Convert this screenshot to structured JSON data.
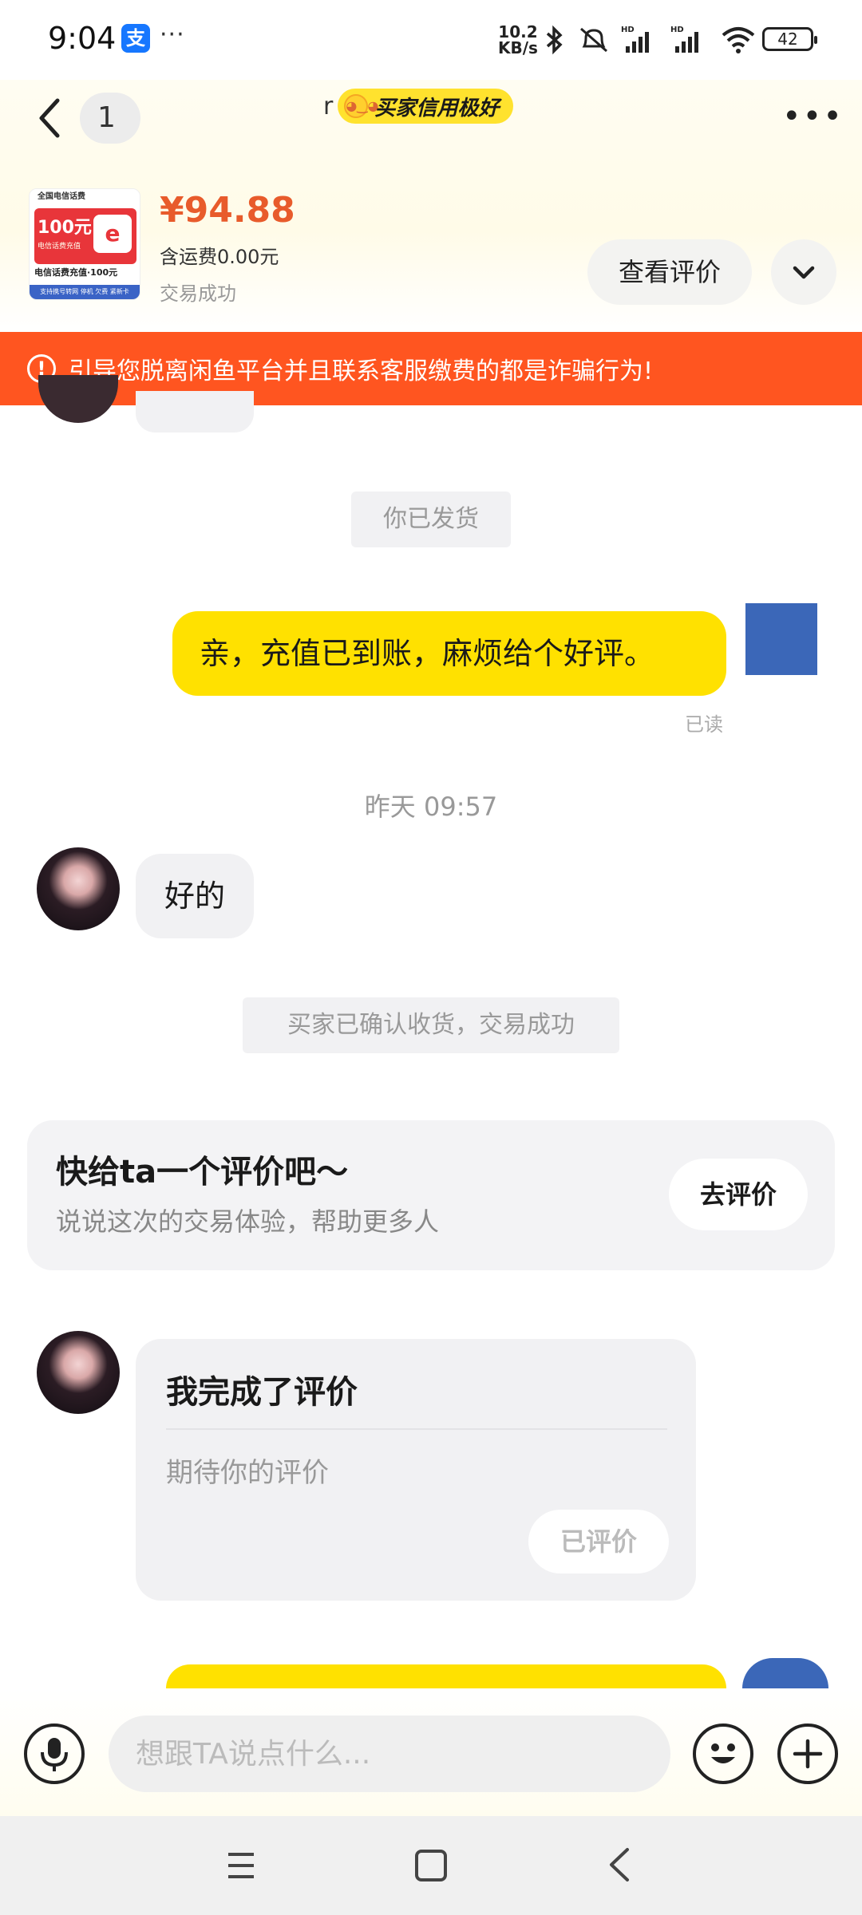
{
  "status_bar": {
    "time": "9:04",
    "app_badge": "支",
    "dots": "···",
    "net_speed_value": "10.2",
    "net_speed_unit": "KB/s",
    "battery": "42"
  },
  "header": {
    "unread_count": "1",
    "title_tail": "r",
    "credit_badge": "买家信用极好"
  },
  "product": {
    "thumb_top": "全国电信话费",
    "thumb_amount": "100元",
    "thumb_sub": "电信话费充值",
    "thumb_logo": "e",
    "thumb_line": "电信话费充值·100元",
    "thumb_foot": "支持携号转网 停机 欠费 紧新卡",
    "price": "¥94.88",
    "shipping": "含运费0.00元",
    "status": "交易成功",
    "view_review_button": "查看评价"
  },
  "warning_banner": {
    "text": "引导您脱离闲鱼平台并且联系客服缴费的都是诈骗行为!"
  },
  "chat": {
    "system_shipped": "你已发货",
    "my_message": "亲，充值已到账，麻烦给个好评。",
    "read_status": "已读",
    "timestamp": "昨天 09:57",
    "their_reply": "好的",
    "system_confirmed": "买家已确认收货，交易成功",
    "review_prompt": {
      "title": "快给ta一个评价吧～",
      "subtitle": "说说这次的交易体验，帮助更多人",
      "button": "去评价"
    },
    "review_done": {
      "title": "我完成了评价",
      "subtitle": "期待你的评价",
      "button": "已评价"
    }
  },
  "input_bar": {
    "placeholder": "想跟TA说点什么..."
  },
  "colors": {
    "accent_yellow": "#ffe100",
    "warning_orange": "#ff5520",
    "price_orange": "#e85b2b"
  }
}
